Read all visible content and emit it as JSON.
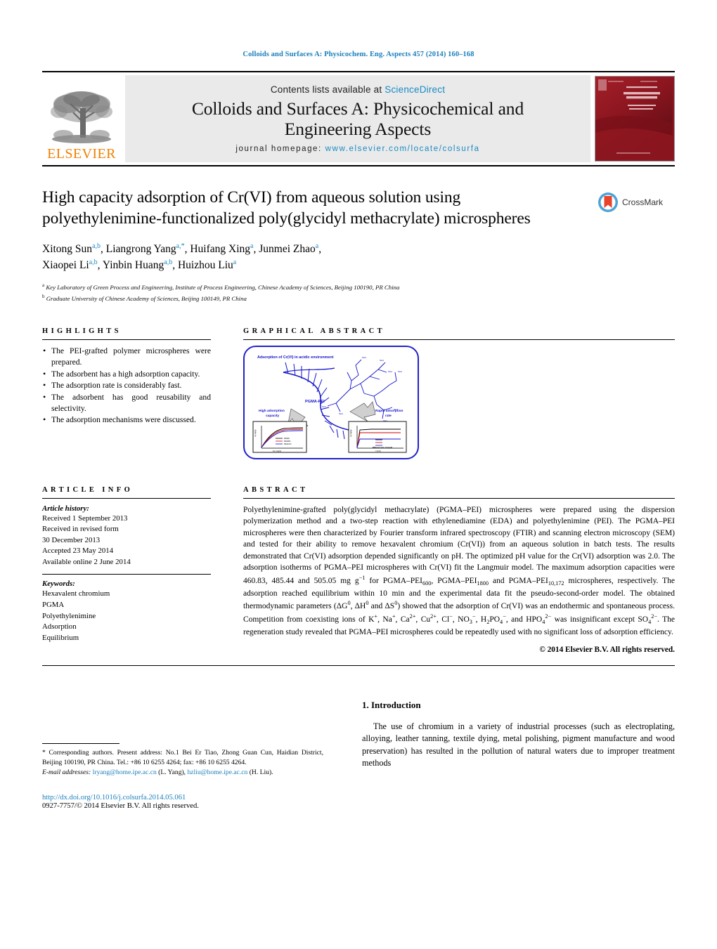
{
  "running_head": "Colloids and Surfaces A: Physicochem. Eng. Aspects 457 (2014) 160–168",
  "masthead": {
    "contents_prefix": "Contents lists available at ",
    "sciencedirect": "ScienceDirect",
    "journal_title": "Colloids and Surfaces A: Physicochemical and Engineering Aspects",
    "homepage_label": "journal homepage:",
    "homepage_url": "www.elsevier.com/locate/colsurfa",
    "publisher_name": "ELSEVIER",
    "cover_line1": "An Internatonal Journal",
    "cover_line2": "COLLOIDS AND SURFACES A",
    "cover_line3": "Physicochemical and Engineering Aspects",
    "accent_orange": "#f08000",
    "link_blue": "#1a8bc4",
    "cover_red": "#8d1620"
  },
  "article": {
    "title": "High capacity adsorption of Cr(VI) from aqueous solution using polyethylenimine-functionalized poly(glycidyl methacrylate) microspheres",
    "authors_line1": "Xitong Sun",
    "authors": [
      {
        "name": "Xitong Sun",
        "marks": "a,b"
      },
      {
        "name": "Liangrong Yang",
        "marks": "a,*"
      },
      {
        "name": "Huifang Xing",
        "marks": "a"
      },
      {
        "name": "Junmei Zhao",
        "marks": "a"
      },
      {
        "name": "Xiaopei Li",
        "marks": "a,b"
      },
      {
        "name": "Yinbin Huang",
        "marks": "a,b"
      },
      {
        "name": "Huizhou Liu",
        "marks": "a"
      }
    ],
    "affiliations": [
      {
        "mark": "a",
        "text": "Key Laboratory of Green Process and Engineering, Institute of Process Engineering, Chinese Academy of Sciences, Beijing 100190, PR China"
      },
      {
        "mark": "b",
        "text": "Graduate University of Chinese Academy of Sciences, Beijing 100149, PR China"
      }
    ],
    "crossmark_label": "CrossMark"
  },
  "highlights": {
    "heading": "HIGHLIGHTS",
    "items": [
      "The PEI-grafted polymer microspheres were prepared.",
      "The adsorbent has a high adsorption capacity.",
      "The adsorption rate is considerably fast.",
      "The adsorbent has good reusability and selectivity.",
      "The adsorption mechanisms were discussed."
    ]
  },
  "graphical_abstract": {
    "heading": "GRAPHICAL ABSTRACT",
    "caption_top": "Adsorption of Cr(VI) in acidic environment",
    "label_center": "PGMA-PEI",
    "label_left": "High adsorption capacity",
    "label_right": "Rapid adsorption rate",
    "left_plot": {
      "ylabel": "q (mg/g)",
      "xlabel": "Ce (mg/L)"
    },
    "right_plot": {
      "ylabel": "q (mg/g)",
      "xlabel": "t (min)",
      "legend_note": "Different ionic strength"
    },
    "border_color": "#2222cc"
  },
  "article_info": {
    "heading": "ARTICLE INFO",
    "history_label": "Article history:",
    "history": [
      "Received 1 September 2013",
      "Received in revised form",
      "30 December 2013",
      "Accepted 23 May 2014",
      "Available online 2 June 2014"
    ],
    "keywords_label": "Keywords:",
    "keywords": [
      "Hexavalent chromium",
      "PGMA",
      "Polyethylenimine",
      "Adsorption",
      "Equilibrium"
    ]
  },
  "abstract": {
    "heading": "ABSTRACT",
    "text_part1": "Polyethylenimine-grafted poly(glycidyl methacrylate) (PGMA–PEI) microspheres were prepared using the dispersion polymerization method and a two-step reaction with ethylenediamine (EDA) and polyethylenimine (PEI). The PGMA–PEI microspheres were then characterized by Fourier transform infrared spectroscopy (FTIR) and scanning electron microscopy (SEM) and tested for their ability to remove hexavalent chromium (Cr(VI)) from an aqueous solution in batch tests. The results demonstrated that Cr(VI) adsorption depended significantly on pH. The optimized pH value for the Cr(VI) adsorption was 2.0. The adsorption isotherms of PGMA–PEI microspheres with Cr(VI) fit the Langmuir model. The maximum adsorption capacities were 460.83, 485.44 and 505.05 mg g",
    "sup1": "−1",
    "text_part2": " for PGMA–PEI",
    "sub1": "600",
    "text_part3": ", PGMA–PEI",
    "sub2": "1800",
    "text_part4": " and PGMA–PEI",
    "sub3": "10,172",
    "text_part5": " microspheres, respectively. The adsorption reached equilibrium within 10 min and the experimental data fit the pseudo-second-order model. The obtained thermodynamic parameters (ΔG",
    "sup2": "0",
    "text_part6": ", ΔH",
    "sup3": "0",
    "text_part7": " and ΔS",
    "sup4": "0",
    "text_part8": ") showed that the adsorption of Cr(VI) was an endothermic and spontaneous process. Competition from coexisting ions of K",
    "sup5": "+",
    "text_part9": ", Na",
    "sup6": "+",
    "text_part10": ", Ca",
    "sup7": "2+",
    "text_part11": ", Cu",
    "sup8": "2+",
    "text_part12": ", Cl",
    "sup9": "−",
    "text_part13": ", NO",
    "sub4": "3",
    "sup10": "−",
    "text_part14": ", H",
    "sub5": "2",
    "text_part15": "PO",
    "sub6": "4",
    "sup11": "−",
    "text_part16": ", and HPO",
    "sub7": "4",
    "sup12": "2−",
    "text_part17": " was insignificant except SO",
    "sub8": "4",
    "sup13": "2−",
    "text_part18": ". The regeneration study revealed that PGMA–PEI microspheres could be repeatedly used with no significant loss of adsorption efficiency.",
    "copyright": "© 2014 Elsevier B.V. All rights reserved."
  },
  "footnote": {
    "corresponding": "* Corresponding authors. Present address: No.1 Bei Er Tiao, Zhong Guan Cun, Haidian District, Beijing 100190, PR China. Tel.: +86 10 6255 4264; fax: +86 10 6255 4264.",
    "email_label": "E-mail addresses:",
    "email1": "lryang@home.ipe.ac.cn",
    "email1_person": "(L. Yang),",
    "email2": "hzliu@home.ipe.ac.cn",
    "email2_person": "(H. Liu).",
    "doi": "http://dx.doi.org/10.1016/j.colsurfa.2014.05.061",
    "issn": "0927-7757/© 2014 Elsevier B.V. All rights reserved."
  },
  "introduction": {
    "number_title": "1.  Introduction",
    "paragraph": "The use of chromium in a variety of industrial processes (such as electroplating, alloying, leather tanning, textile dying, metal polishing, pigment manufacture and wood preservation) has resulted in the pollution of natural waters due to improper treatment methods"
  }
}
